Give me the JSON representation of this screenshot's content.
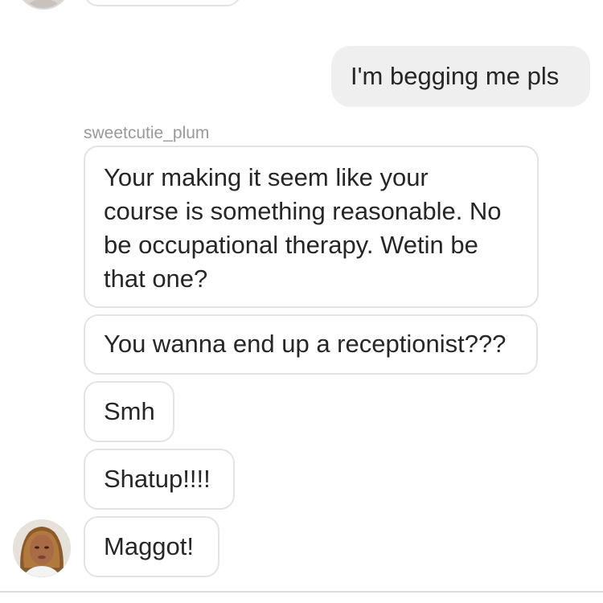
{
  "conversation": {
    "sender_name": "sweetcutie_plum",
    "messages": [
      {
        "direction": "sent",
        "text": "I'm begging me pls"
      },
      {
        "direction": "received",
        "lines": [
          "Your making it seem like your",
          "course is something reasonable. No",
          "be occupational therapy. Wetin be",
          "that one?"
        ]
      },
      {
        "direction": "received",
        "text": "You wanna end up a receptionist???"
      },
      {
        "direction": "received",
        "text": "Smh"
      },
      {
        "direction": "received",
        "text": "Shatup!!!!"
      },
      {
        "direction": "received",
        "text": "Maggot!"
      }
    ]
  },
  "colors": {
    "sent_bubble": "#efefef",
    "received_border": "#e3e3e3",
    "text": "#262626",
    "sender_name": "#999999"
  },
  "icons": {
    "avatar": "user-avatar-photo"
  }
}
